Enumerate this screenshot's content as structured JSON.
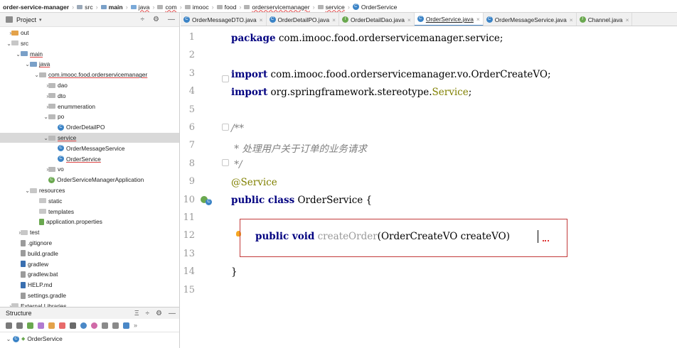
{
  "breadcrumb": [
    {
      "label": "order-service-manager",
      "kind": "module"
    },
    {
      "label": "src",
      "kind": "folder"
    },
    {
      "label": "main",
      "kind": "folder"
    },
    {
      "label": "java",
      "kind": "folder"
    },
    {
      "label": "com",
      "kind": "folder"
    },
    {
      "label": "imooc",
      "kind": "folder"
    },
    {
      "label": "food",
      "kind": "folder"
    },
    {
      "label": "orderservicemanager",
      "kind": "folder"
    },
    {
      "label": "service",
      "kind": "folder"
    },
    {
      "label": "OrderService",
      "kind": "class"
    }
  ],
  "project_panel": {
    "title": "Project",
    "dropdown": "▾",
    "tools": [
      "÷",
      "⚙",
      "—"
    ]
  },
  "tree": [
    {
      "label": "out",
      "arrow": "›",
      "icon": "folder-orange",
      "indent": 0
    },
    {
      "label": "src",
      "arrow": "⌄",
      "icon": "folder",
      "indent": 0
    },
    {
      "label": "main",
      "arrow": "⌄",
      "icon": "folder-blue",
      "indent": 1,
      "redline": true
    },
    {
      "label": "java",
      "arrow": "⌄",
      "icon": "folder-blue",
      "indent": 2,
      "redline": true
    },
    {
      "label": "com.imooc.food.orderservicemanager",
      "arrow": "⌄",
      "icon": "folder-pkg",
      "indent": 3,
      "redline": true
    },
    {
      "label": "dao",
      "arrow": "›",
      "icon": "folder-pkg",
      "indent": 4
    },
    {
      "label": "dto",
      "arrow": "›",
      "icon": "folder-pkg",
      "indent": 4
    },
    {
      "label": "enummeration",
      "arrow": "›",
      "icon": "folder-pkg",
      "indent": 4
    },
    {
      "label": "po",
      "arrow": "⌄",
      "icon": "folder-pkg",
      "indent": 4
    },
    {
      "label": "OrderDetailPO",
      "arrow": "",
      "icon": "class",
      "indent": 5
    },
    {
      "label": "service",
      "arrow": "⌄",
      "icon": "folder-pkg",
      "indent": 4,
      "selected": true,
      "redline": true
    },
    {
      "label": "OrderMessageService",
      "arrow": "",
      "icon": "class",
      "indent": 5
    },
    {
      "label": "OrderService",
      "arrow": "",
      "icon": "class",
      "indent": 5,
      "redline": true
    },
    {
      "label": "vo",
      "arrow": "›",
      "icon": "folder-pkg",
      "indent": 4
    },
    {
      "label": "OrderServiceManagerApplication",
      "arrow": "",
      "icon": "class-spring",
      "indent": 4
    },
    {
      "label": "resources",
      "arrow": "⌄",
      "icon": "folder",
      "indent": 2
    },
    {
      "label": "static",
      "arrow": "",
      "icon": "folder",
      "indent": 3
    },
    {
      "label": "templates",
      "arrow": "",
      "icon": "folder",
      "indent": 3
    },
    {
      "label": "application.properties",
      "arrow": "",
      "icon": "file-green",
      "indent": 3
    },
    {
      "label": "test",
      "arrow": "›",
      "icon": "folder",
      "indent": 1
    },
    {
      "label": ".gitignore",
      "arrow": "",
      "icon": "file",
      "indent": 1
    },
    {
      "label": "build.gradle",
      "arrow": "",
      "icon": "file",
      "indent": 1
    },
    {
      "label": "gradlew",
      "arrow": "",
      "icon": "file-blue",
      "indent": 1
    },
    {
      "label": "gradlew.bat",
      "arrow": "",
      "icon": "file",
      "indent": 1
    },
    {
      "label": "HELP.md",
      "arrow": "",
      "icon": "file-blue",
      "indent": 1
    },
    {
      "label": "settings.gradle",
      "arrow": "",
      "icon": "file",
      "indent": 1
    },
    {
      "label": "External Libraries",
      "arrow": "›",
      "icon": "folder",
      "indent": 0
    }
  ],
  "structure_panel": {
    "title": "Structure",
    "tools": [
      "Ξ",
      "÷",
      "⚙",
      "—"
    ],
    "item": "OrderService"
  },
  "tabs": [
    {
      "label": "OrderMessageDTO.java",
      "icon": "C",
      "active": false
    },
    {
      "label": "OrderDetailPO.java",
      "icon": "C",
      "active": false
    },
    {
      "label": "OrderDetailDao.java",
      "icon": "I",
      "active": false
    },
    {
      "label": "OrderService.java",
      "icon": "C",
      "active": true
    },
    {
      "label": "OrderMessageService.java",
      "icon": "C",
      "active": false
    },
    {
      "label": "Channel.java",
      "icon": "I",
      "active": false
    }
  ],
  "editor": {
    "line_numbers": [
      "1",
      "2",
      "3",
      "4",
      "5",
      "6",
      "7",
      "8",
      "9",
      "10",
      "11",
      "12",
      "13",
      "14",
      "15"
    ],
    "lines": {
      "l1_kw": "package",
      "l1_rest": " com.imooc.food.orderservicemanager.service;",
      "l3_kw": "import",
      "l3_rest": " com.imooc.food.orderservicemanager.vo.OrderCreateVO;",
      "l4_kw": "import",
      "l4_rest": " org.springframework.stereotype.",
      "l4_cls": "Service",
      "l4_end": ";",
      "l6": "/**",
      "l7": " * 处理用户关于订单的业务请求",
      "l8": " */",
      "l9": "@Service",
      "l10_kw": "public class",
      "l10_rest": " OrderService {",
      "l12_kw": "public void",
      "l12_method": " createOrder",
      "l12_rest": "(OrderCreateVO ",
      "l12_param": "createVO",
      ")": ")",
      "l14": "}"
    }
  }
}
